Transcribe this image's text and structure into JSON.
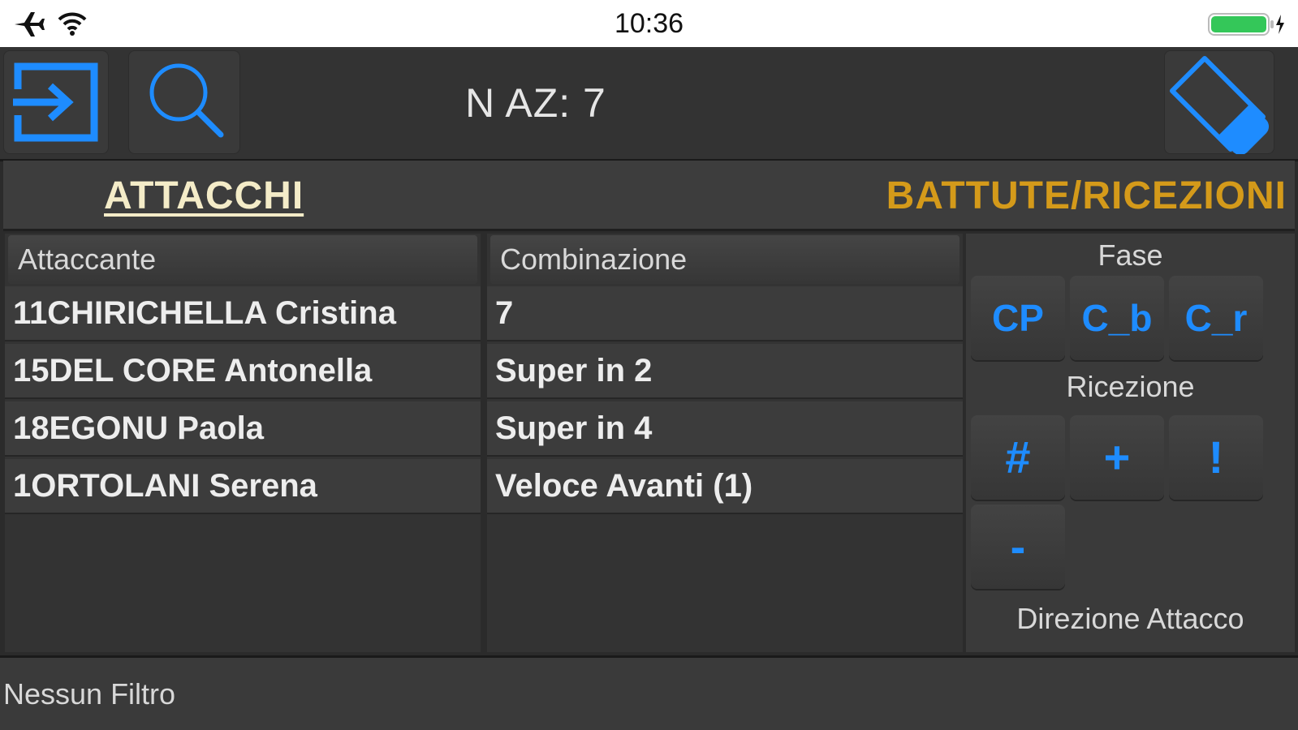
{
  "status_bar": {
    "time": "10:36",
    "icons": [
      "airplane-icon",
      "wifi-icon",
      "battery-charging-icon"
    ],
    "battery_color": "#34c759"
  },
  "toolbar": {
    "login_icon": "login-icon",
    "search_icon": "search-icon",
    "title": "N AZ: 7",
    "eraser_icon": "eraser-icon",
    "icon_color": "#1e8cff"
  },
  "tabs": {
    "attacchi": "ATTACCHI",
    "battute_ricezioni": "BATTUTE/RICEZIONI",
    "active_color": "#f4ecc8",
    "inactive_color": "#d49a1a"
  },
  "table": {
    "columns": [
      "Attaccante",
      "Combinazione"
    ],
    "rows": [
      {
        "attaccante": "11CHIRICHELLA Cristina",
        "combinazione": "7"
      },
      {
        "attaccante": "15DEL CORE Antonella",
        "combinazione": "Super in 2"
      },
      {
        "attaccante": "18EGONU Paola",
        "combinazione": "Super in 4"
      },
      {
        "attaccante": "1ORTOLANI Serena",
        "combinazione": "Veloce Avanti (1)"
      }
    ]
  },
  "side_panel": {
    "fase_label": "Fase",
    "fase_buttons": [
      "CP",
      "C_b",
      "C_r"
    ],
    "ricezione_label": "Ricezione",
    "ricezione_buttons": [
      "#",
      "+",
      "!",
      "-"
    ],
    "direzione_label": "Direzione Attacco"
  },
  "footer": {
    "filter_text": "Nessun Filtro"
  }
}
